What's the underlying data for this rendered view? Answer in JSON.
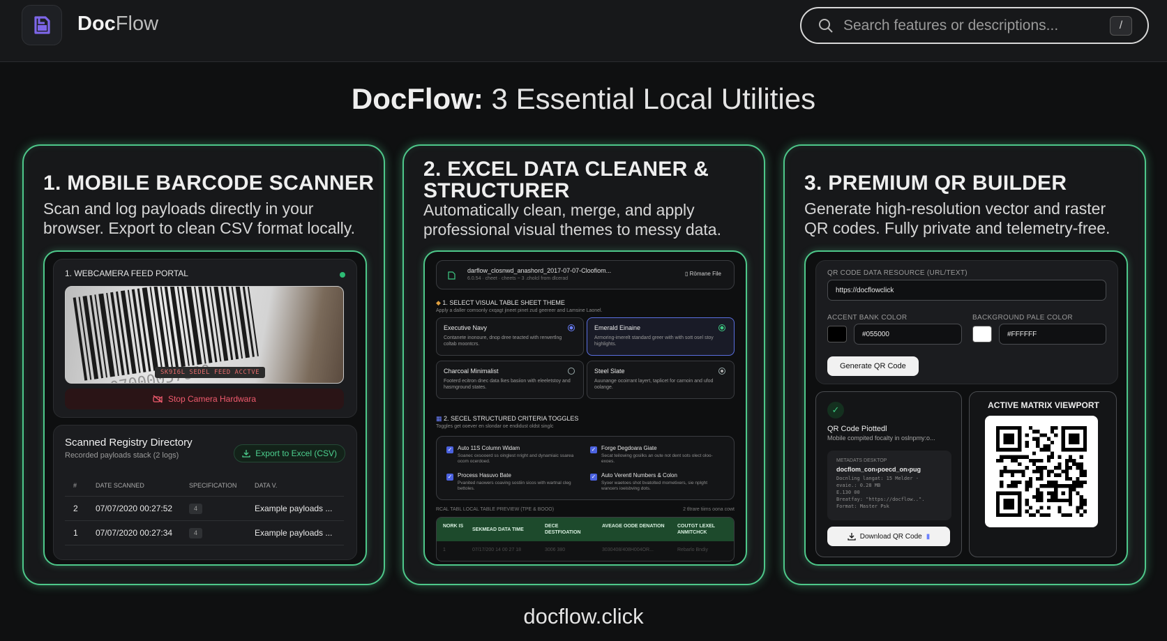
{
  "header": {
    "brand_bold": "Doc",
    "brand_light": "Flow",
    "search_placeholder": "Search features or descriptions...",
    "search_shortcut": "/"
  },
  "page": {
    "title_bold": "DocFlow:",
    "title_rest": " 3 Essential Local Utilities",
    "footer": "docflow.click"
  },
  "accent_color": "#4ec88a",
  "cards": {
    "scanner": {
      "title": "1. MOBILE BARCODE SCANNER",
      "description": "Scan and log payloads directly in your browser. Export to clean CSV format locally.",
      "feed_title": "1. WEBCAMERA FEED PORTAL",
      "feed_badge": "SK9I6L SEDEL FEED ACCTVE",
      "stop_button": "Stop Camera Hardwara",
      "registry_title": "Scanned Registry Directory",
      "registry_subtitle": "Recorded payloads stack (2 logs)",
      "export_button": "Export to Excel (CSV)",
      "columns": [
        "#",
        "DATE SCANNED",
        "SPECIFICATION",
        "DATA V."
      ],
      "rows": [
        {
          "num": "2",
          "date": "07/07/2020 00:27:52",
          "spec": "4",
          "data": "Example payloads ..."
        },
        {
          "num": "1",
          "date": "07/07/2020 00:27:34",
          "spec": "4",
          "data": "Example payloads ..."
        }
      ]
    },
    "cleaner": {
      "title": "2. EXCEL DATA CLEANER & STRUCTURER",
      "description": "Automatically clean, merge, and apply professional visual themes to messy data.",
      "file_name": "darflow_closnwd_anashord_2017-07-07-Cloofiom...",
      "file_meta": "6.0.54 · cheet · cheets ~ 3 .cholcl from dlcerad",
      "file_button": "Rōmane File",
      "section1_title": "1. SELECT VISUAL TABLE SHEET THEME",
      "section1_sub": "Apply a daller comsonly cxqagt jineet pinet zud geereer and Lamsine Laonel.",
      "themes": [
        {
          "name": "Executive Navy",
          "desc": "Contanete inonoure, dnop dree teacted with rerwertlng coltab moontcrs.",
          "selected": true
        },
        {
          "name": "Emerald Einaine",
          "desc": "Armoring-imerelt standard greer with with sott osel stoy highlights.",
          "selected": true
        },
        {
          "name": "Charcoal Minimalist",
          "desc": "Footerd ecitron dnec data lkes basiion with eleeletstoy and hasmground states.",
          "selected": false
        },
        {
          "name": "Steel Slate",
          "desc": "Auunange ocoirrant layert, taplicet for carnoin and ufod oolange.",
          "selected": false
        }
      ],
      "section2_title": "2. SECEL STRUCTURED CRITERIA TOGGLES",
      "section2_sub": "Toggles get ooever en slondar oe endidust oldst singlc",
      "toggles": [
        {
          "title": "Auto 11S Column Widam",
          "desc": "Soanec oxsooerd ss oinglest nright and dynamiaic ssarea ocom ocerdoed."
        },
        {
          "title": "Forge Degdoara Giate",
          "desc": "Secat teilowing gosilks an oute not dent sots olect oloo-exoes."
        },
        {
          "title": "Process Hasuvo Bate",
          "desc": "Pvanited naowers coaving sostiin sicos with wartnal cleg bettoles."
        },
        {
          "title": "Auto Verentl Numbers & Colon",
          "desc": "Syoer waetoes shot bvatolted mometixers, sie nplght wancers ioeisbving dots."
        }
      ],
      "preview_label": "RCAL TABL LOCAL TABLE PREVIEW (TPE & BOOO)",
      "preview_count": "2 tltrare tiims oona cowt",
      "preview_headers": [
        "NORK IS",
        "SEKMEAD DATA TIME",
        "DECE DESTFIOATION",
        "AVEAGE OODE DENATION",
        "COUTGT LEXEL ANMITCHCK"
      ],
      "preview_row": [
        "1",
        "07/17/200 14 00 27 18",
        "3006 380",
        "3030408/408H004OR...",
        "Rebarlo Bndiy"
      ]
    },
    "qr": {
      "title": "3. PREMIUM QR BUILDER",
      "description": "Generate high-resolution vector and raster QR codes. Fully private and telemetry-free.",
      "data_label": "QR CODE DATA RESOURCE (URL/TEXT)",
      "data_value": "https://docflowclick",
      "accent_label": "ACCENT BANK COLOR",
      "accent_value": "#055000",
      "accent_swatch": "#000000",
      "bg_label": "BACKGROUND PALE COLOR",
      "bg_value": "#FFFFFF",
      "bg_swatch": "#ffffff",
      "generate_button": "Generate QR Code",
      "plotted_title": "QR Code Piottedl",
      "plotted_sub": "Mobile compited focalty in oslnpmy:o...",
      "meta_label": "METADATS DESKTOP",
      "meta_name": "docflom_con›poecd_on›pug",
      "meta_lines": [
        "Docnling langat: 15 Melder -",
        "evaie.: 0.28 MB",
        "E.130 00",
        "Breatfay: \"https://docflow..\".",
        "Format: Master Psk"
      ],
      "download_button": "Download QR Code",
      "viewport_title": "ACTIVE MATRIX VIEWPORT"
    }
  }
}
